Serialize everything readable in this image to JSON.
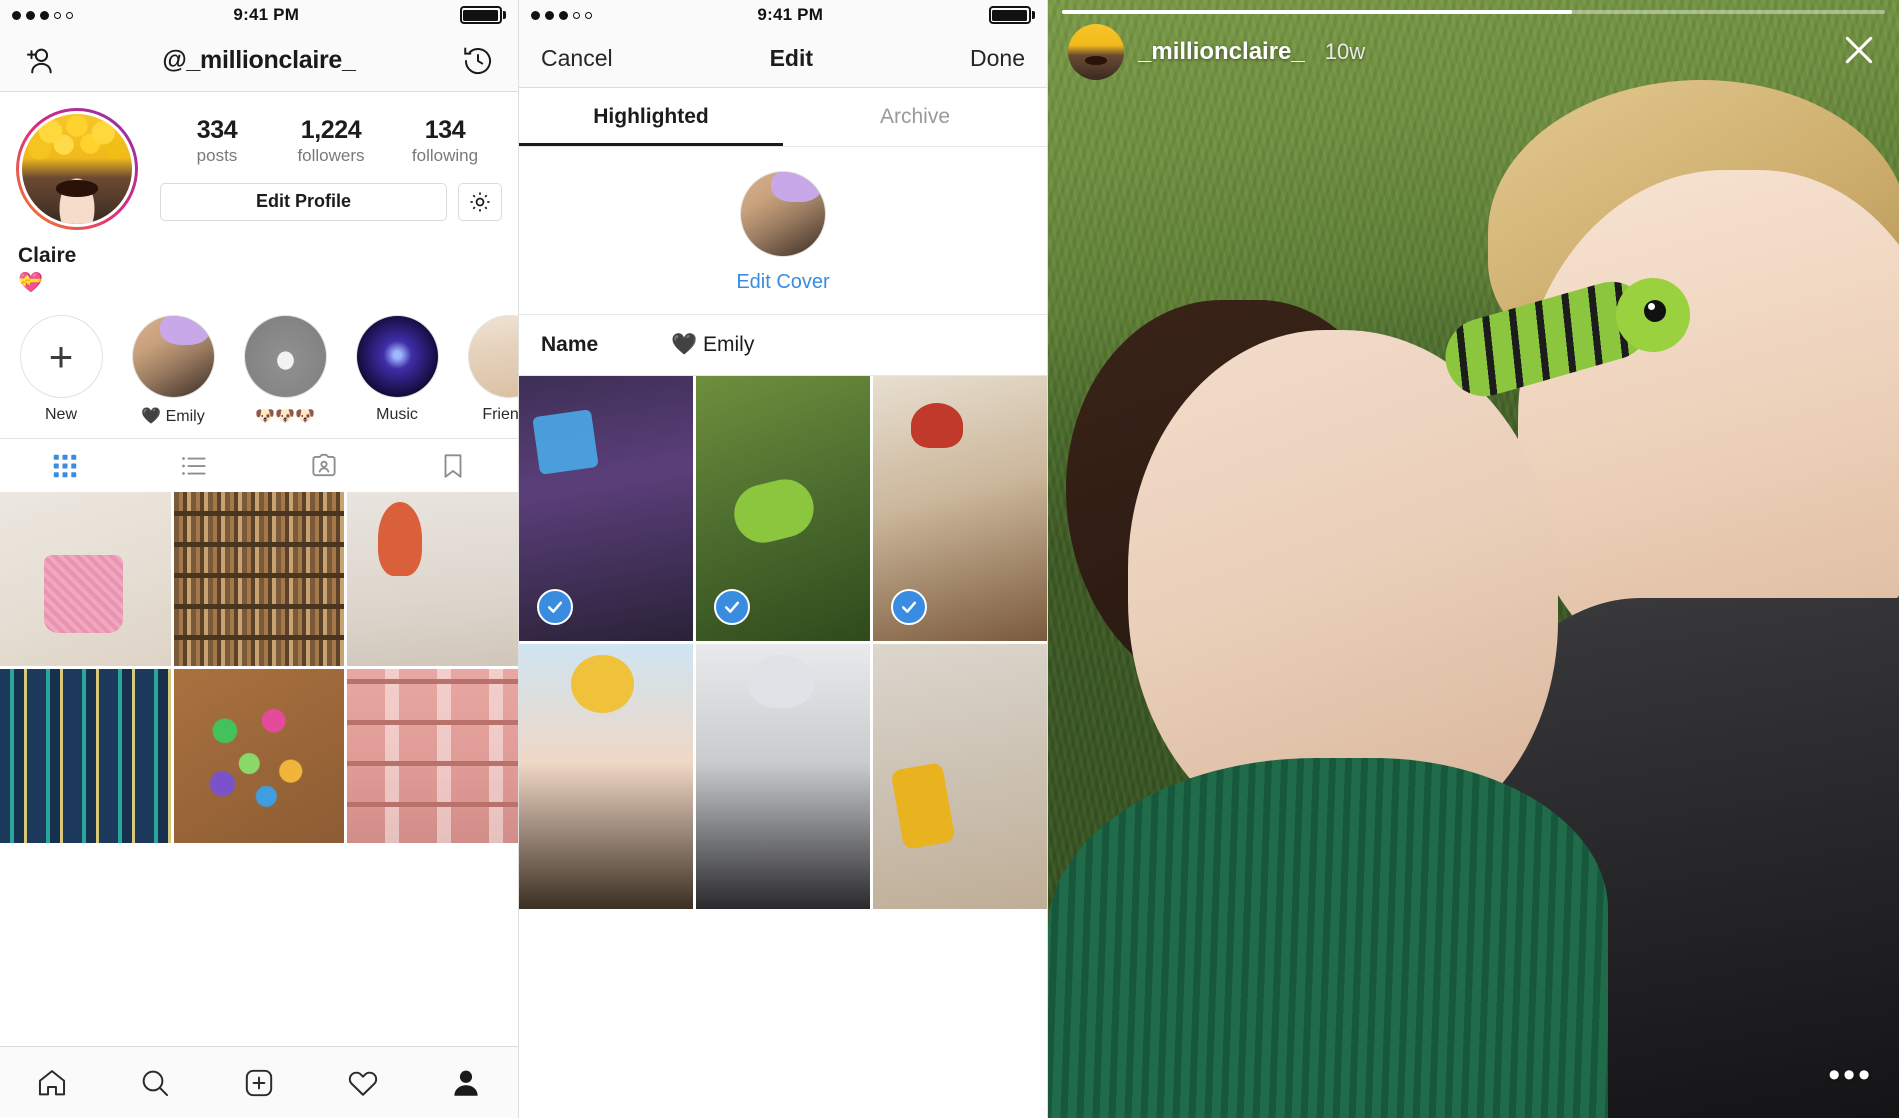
{
  "status_bar": {
    "signal_filled": 3,
    "signal_total": 5,
    "time": "9:41 PM"
  },
  "profile": {
    "nav": {
      "add_person_icon": "add-person-icon",
      "title": "@_millionclaire_",
      "archive_icon": "history-clock-icon"
    },
    "stats": [
      {
        "num": "334",
        "label": "posts"
      },
      {
        "num": "1,224",
        "label": "followers"
      },
      {
        "num": "134",
        "label": "following"
      }
    ],
    "edit_profile_label": "Edit Profile",
    "settings_icon": "gear-icon",
    "bio": {
      "name": "Claire",
      "line1": "💝"
    },
    "highlights": [
      {
        "label": "New",
        "kind": "new"
      },
      {
        "label": "🖤 Emily",
        "kind": "emily"
      },
      {
        "label": "🐶🐶🐶",
        "kind": "dog"
      },
      {
        "label": "Music",
        "kind": "music"
      },
      {
        "label": "Friends",
        "kind": "friends"
      }
    ],
    "grid_tabs": [
      {
        "icon": "grid-icon",
        "active": true
      },
      {
        "icon": "list-icon",
        "active": false
      },
      {
        "icon": "tagged-person-icon",
        "active": false
      },
      {
        "icon": "bookmark-icon",
        "active": false
      }
    ],
    "posts": [
      {
        "alt": "pink beaded handbag",
        "style": "g-bag"
      },
      {
        "alt": "bookshelf wall",
        "style": "g-books"
      },
      {
        "alt": "mermaid wall art selfie",
        "style": "g-mermaid"
      },
      {
        "alt": "striped blue bleachers",
        "style": "g-stripes"
      },
      {
        "alt": "colorful paper cranes",
        "style": "g-origami"
      },
      {
        "alt": "pink apartment building",
        "style": "g-house"
      }
    ],
    "bottom_nav": [
      {
        "icon": "home-icon",
        "active": false
      },
      {
        "icon": "search-icon",
        "active": false
      },
      {
        "icon": "add-post-icon",
        "active": false
      },
      {
        "icon": "heart-icon",
        "active": false
      },
      {
        "icon": "profile-icon",
        "active": true
      }
    ]
  },
  "edit": {
    "nav": {
      "cancel": "Cancel",
      "title": "Edit",
      "done": "Done"
    },
    "tabs": [
      {
        "label": "Highlighted",
        "active": true
      },
      {
        "label": "Archive",
        "active": false
      }
    ],
    "cover": {
      "edit_cover_label": "Edit Cover",
      "link_color": "#3a8ce0"
    },
    "name_row": {
      "label": "Name",
      "value": "🖤 Emily"
    },
    "media": [
      {
        "alt": "friends at party",
        "style": "e1",
        "selected": true
      },
      {
        "alt": "two girls on grass with caterpillar",
        "style": "e2",
        "selected": true
      },
      {
        "alt": "girl in red beret at doorway",
        "style": "e3",
        "selected": true
      },
      {
        "alt": "selfie with sun filter",
        "style": "e4",
        "selected": false
      },
      {
        "alt": "selfie with rain cloud filter",
        "style": "e5",
        "selected": false
      },
      {
        "alt": "yellow shoes on rug",
        "style": "e6",
        "selected": false
      }
    ],
    "check_color": "#3a8ce0"
  },
  "story": {
    "username": "_millionclaire_",
    "timestamp": "10w",
    "close_icon": "close-icon",
    "more_icon": "more-options-icon",
    "progress_percent": 62
  }
}
